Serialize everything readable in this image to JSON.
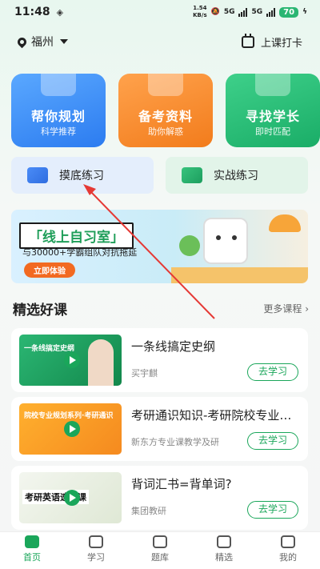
{
  "status_bar": {
    "time": "11:48",
    "speed_value": "1.54",
    "speed_unit": "KB/s",
    "net1": "5G",
    "net2": "5G",
    "battery": "70"
  },
  "header": {
    "city": "福州",
    "checkin_label": "上课打卡"
  },
  "feature_cards": [
    {
      "title": "帮你规划",
      "subtitle": "科学推荐"
    },
    {
      "title": "备考资料",
      "subtitle": "助你解惑"
    },
    {
      "title": "寻找学长",
      "subtitle": "即时匹配"
    }
  ],
  "practice": [
    {
      "label": "摸底练习"
    },
    {
      "label": "实战练习"
    }
  ],
  "banner": {
    "title": "「线上自习室」",
    "subtitle": "与30000+学霸组队对抗拖延",
    "button": "立即体验"
  },
  "section": {
    "title": "精选好课",
    "more": "更多课程 ›"
  },
  "courses": [
    {
      "thumb_text": "一条线搞定史纲",
      "title": "一条线搞定史纲",
      "teacher": "买宇麒",
      "action": "去学习"
    },
    {
      "thumb_text": "院校专业规划系列·考研通识",
      "title": "考研通识知识-考研院校专业选择",
      "teacher": "新东方专业课教学及研",
      "action": "去学习"
    },
    {
      "thumb_text": "考研英语速抗课",
      "title": "背词汇书=背单词?",
      "teacher": "集团教研",
      "action": "去学习"
    }
  ],
  "nav": [
    {
      "label": "首页",
      "active": true
    },
    {
      "label": "学习"
    },
    {
      "label": "题库"
    },
    {
      "label": "精选"
    },
    {
      "label": "我的"
    }
  ],
  "colors": {
    "brand_green": "#1aa65a",
    "annotation_red": "#e53935"
  }
}
